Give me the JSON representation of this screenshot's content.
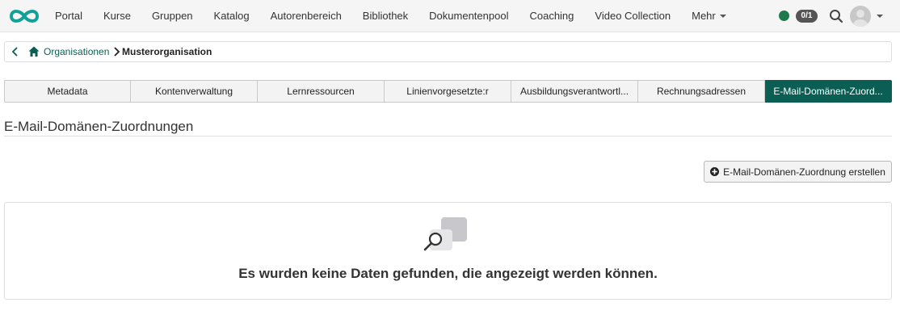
{
  "nav": {
    "items": [
      "Portal",
      "Kurse",
      "Gruppen",
      "Katalog",
      "Autorenbereich",
      "Bibliothek",
      "Dokumentenpool",
      "Coaching",
      "Video Collection",
      "Mehr"
    ],
    "count_badge": "0/1",
    "status_color": "#1e7a4c"
  },
  "breadcrumb": {
    "parent": "Organisationen",
    "current": "Musterorganisation"
  },
  "tabs": [
    "Metadata",
    "Kontenverwaltung",
    "Lernressourcen",
    "Linienvorgesetzte:r",
    "Ausbildungsverantwortl...",
    "Rechnungsadressen",
    "E-Mail-Domänen-Zuord..."
  ],
  "active_tab": "E-Mail-Domänen-Zuord...",
  "page": {
    "title": "E-Mail-Domänen-Zuordnungen",
    "create_button": "E-Mail-Domänen-Zuordnung erstellen",
    "empty_message": "Es wurden keine Daten gefunden, die angezeigt werden können."
  },
  "colors": {
    "accent": "#0b5e54",
    "logo": "#12a198"
  },
  "icons": [
    "infinity-logo-icon",
    "search-icon",
    "chevron-left-icon",
    "home-icon",
    "chevron-right-icon",
    "plus-circle-icon",
    "empty-data-icon"
  ]
}
